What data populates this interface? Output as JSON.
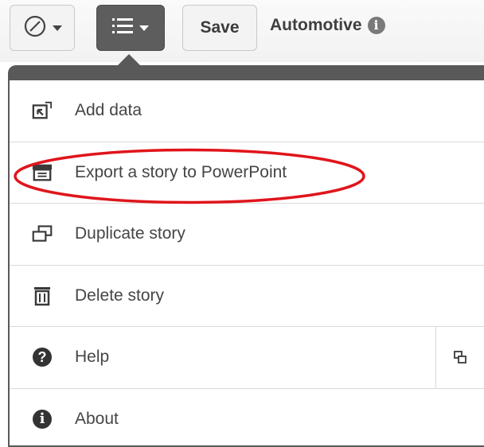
{
  "toolbar": {
    "save_label": "Save",
    "app_title": "Automotive",
    "nav_icon": "compass-icon",
    "menu_icon": "list-menu-icon",
    "info_icon": "info-icon"
  },
  "menu": {
    "items": [
      {
        "label": "Add data",
        "icon": "add-data-icon"
      },
      {
        "label": "Export a story to PowerPoint",
        "icon": "presentation-icon"
      },
      {
        "label": "Duplicate story",
        "icon": "duplicate-icon"
      },
      {
        "label": "Delete story",
        "icon": "trash-icon"
      },
      {
        "label": "Help",
        "icon": "help-icon"
      },
      {
        "label": "About",
        "icon": "about-icon"
      }
    ],
    "help_extra_icon": "external-link-icon"
  },
  "colors": {
    "menu_dark": "#595959",
    "highlight_red": "#e0151b"
  }
}
